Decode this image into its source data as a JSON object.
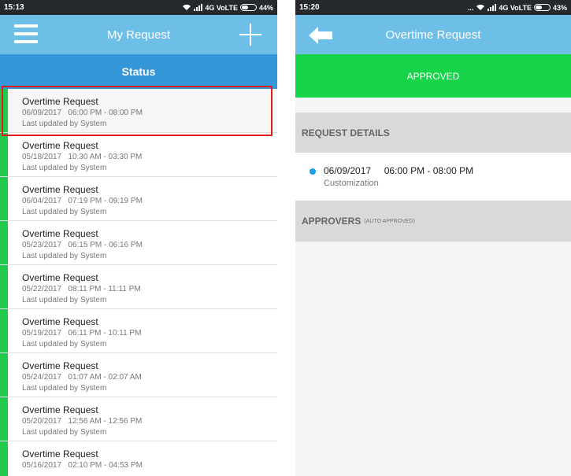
{
  "left": {
    "status_bar": {
      "time": "15:13",
      "network": "4G VoLTE",
      "battery": "44%"
    },
    "header": {
      "title": "My Request"
    },
    "tab": {
      "label": "Status"
    },
    "requests": [
      {
        "title": "Overtime Request",
        "date": "06/09/2017",
        "time": "06:00 PM - 08:00 PM",
        "updated": "Last updated by System"
      },
      {
        "title": "Overtime Request",
        "date": "05/18/2017",
        "time": "10:30 AM - 03:30 PM",
        "updated": "Last updated by System"
      },
      {
        "title": "Overtime Request",
        "date": "06/04/2017",
        "time": "07:19 PM - 09:19 PM",
        "updated": "Last updated by System"
      },
      {
        "title": "Overtime Request",
        "date": "05/23/2017",
        "time": "06:15 PM - 06:16 PM",
        "updated": "Last updated by System"
      },
      {
        "title": "Overtime Request",
        "date": "05/22/2017",
        "time": "08:11 PM - 11:11 PM",
        "updated": "Last updated by System"
      },
      {
        "title": "Overtime Request",
        "date": "05/19/2017",
        "time": "06:11 PM - 10:11 PM",
        "updated": "Last updated by System"
      },
      {
        "title": "Overtime Request",
        "date": "05/24/2017",
        "time": "01:07 AM - 02:07 AM",
        "updated": "Last updated by System"
      },
      {
        "title": "Overtime Request",
        "date": "05/20/2017",
        "time": "12:56 AM - 12:56 PM",
        "updated": "Last updated by System"
      },
      {
        "title": "Overtime Request",
        "date": "05/16/2017",
        "time": "02:10 PM - 04:53 PM",
        "updated": ""
      }
    ]
  },
  "right": {
    "status_bar": {
      "time": "15:20",
      "network": "4G VoLTE",
      "battery": "43%"
    },
    "header": {
      "title": "Overtime Request"
    },
    "status_banner": "APPROVED",
    "details_section": {
      "heading": "REQUEST DETAILS",
      "date": "06/09/2017",
      "time": "06:00 PM - 08:00 PM",
      "category": "Customization"
    },
    "approvers_section": {
      "heading": "APPROVERS",
      "note": "(AUTO APPROVED)"
    }
  },
  "colors": {
    "header": "#6ebfe8",
    "tab": "#3597d8",
    "approved": "#16d34a",
    "status_bar_green": "#23c94a",
    "highlight": "#e11b1b",
    "bullet": "#1c9ee9"
  },
  "icons": {
    "menu": "hamburger-menu-icon",
    "add": "plus-icon",
    "back": "back-arrow-icon",
    "wifi": "wifi-icon",
    "signal": "signal-icon",
    "battery": "battery-icon"
  }
}
